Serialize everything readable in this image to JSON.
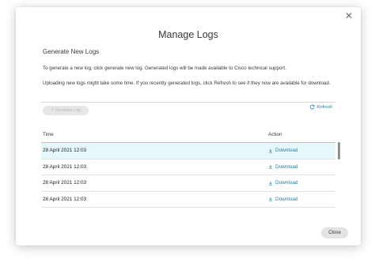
{
  "dialog": {
    "title": "Manage Logs",
    "section_heading": "Generate New Logs",
    "description_1": "To generate a new log, click generate new log. Generated logs will be made available to Cisco technical support.",
    "description_2": "Uploading new logs might take some time. If you recently generated logs, click Refresh to see if they now are available for download.",
    "generate_button_label": "Generate Log",
    "refresh_label": "Refresh",
    "close_button_label": "Close",
    "close_icon": "close-icon"
  },
  "table": {
    "headers": {
      "time": "Time",
      "action": "Action"
    },
    "rows": [
      {
        "time": "28 April 2021 12:03",
        "action": "Download",
        "selected": true
      },
      {
        "time": "28 April 2021 12:03",
        "action": "Download",
        "selected": false
      },
      {
        "time": "28 April 2021 12:03",
        "action": "Download",
        "selected": false
      },
      {
        "time": "28 April 2021 12:03",
        "action": "Download",
        "selected": false
      }
    ]
  },
  "colors": {
    "accent": "#1d86a8",
    "selected_row": "#e6f7fb",
    "disabled_button": "#e6e6e6"
  }
}
